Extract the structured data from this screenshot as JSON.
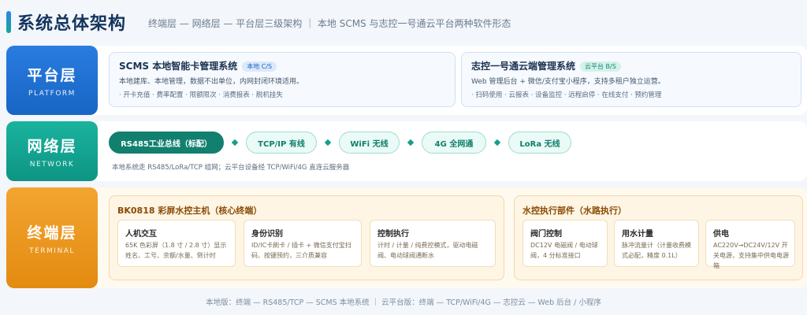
{
  "header": {
    "title": "系统总体架构",
    "subtitle": "终端层 — 网络层 — 平台层三级架构 ｜ 本地 SCMS 与志控一号通云平台两种软件形态"
  },
  "colors": {
    "platform": "#1765c4",
    "network": "#0e9584",
    "terminal": "#e48b10"
  },
  "platform": {
    "name": "平台层",
    "en": "PLATFORM",
    "cards": [
      {
        "title": "SCMS 本地智能卡管理系统",
        "tag": "本地 C/S",
        "desc": "本地建库、本地管理，数据不出单位，内网封闭环境适用。",
        "features": "· 开卡充值 · 费率配置 · 限额限次 · 消费报表 · 脱机挂失"
      },
      {
        "title": "志控一号通云端管理系统",
        "tag": "云平台 B/S",
        "desc": "Web 管理后台 + 微信/支付宝小程序，支持多租户独立运营。",
        "features": "· 扫码使用 · 云报表 · 设备监控 · 远程启停 · 在线支付 · 预约管理"
      }
    ]
  },
  "network": {
    "name": "网络层",
    "en": "NETWORK",
    "pills": [
      "RS485工业总线（标配）",
      "TCP/IP 有线",
      "WiFi 无线",
      "4G 全网通",
      "LoRa 无线"
    ],
    "note": "本地系统走 RS485/LoRa/TCP 组网；云平台设备经 TCP/WiFi/4G 直连云服务器"
  },
  "terminal": {
    "name": "终端层",
    "en": "TERMINAL",
    "host": {
      "title": "BK0818 彩屏水控主机（核心终端）",
      "cards": [
        {
          "title": "人机交互",
          "desc": "65K 色彩屏（1.8 寸 / 2.8 寸）显示姓名、工号、余额/水量、倒计时"
        },
        {
          "title": "身份识别",
          "desc": "ID/IC卡刷卡 / 插卡 + 微信支付宝扫码、按键预约，三介质兼容"
        },
        {
          "title": "控制执行",
          "desc": "计时 / 计量 / 纯费控模式，驱动电磁阀、电动球阀通断水"
        }
      ]
    },
    "exec": {
      "title": "水控执行部件（水路执行）",
      "cards": [
        {
          "title": "阀门控制",
          "desc": "DC12V 电磁阀 / 电动球阀，4 分标准接口"
        },
        {
          "title": "用水计量",
          "desc": "脉冲流量计（计量收费模式必配，精度 0.1L）"
        },
        {
          "title": "供电",
          "desc": "AC220V→DC24V/12V 开关电源，支持集中供电电源箱"
        }
      ]
    }
  },
  "footer": "本地版：终端 — RS485/TCP — SCMS 本地系统 ｜ 云平台版：终端 — TCP/WiFi/4G — 志控云 — Web 后台 / 小程序"
}
